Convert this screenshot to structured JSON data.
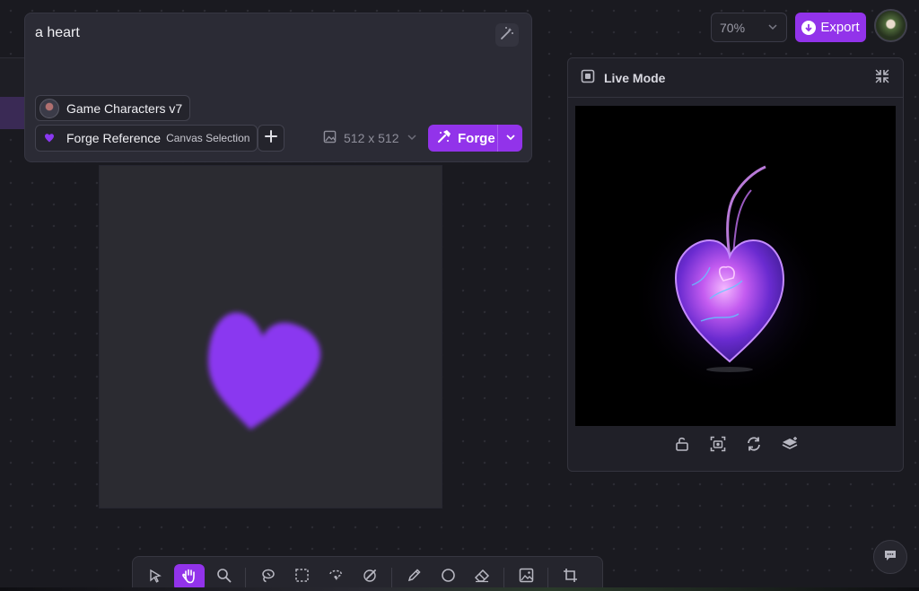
{
  "prompt": {
    "text": "a heart",
    "model_label": "Game Characters v7",
    "reference_label": "Forge Reference",
    "reference_sub": "Canvas Selection",
    "size_label": "512 x 512",
    "forge_label": "Forge"
  },
  "header": {
    "zoom_label": "70%",
    "export_label": "Export"
  },
  "live_mode": {
    "title": "Live Mode"
  },
  "colors": {
    "accent": "#9233ea",
    "heart_sketch": "#8a38f0"
  },
  "toolbar": {
    "tools": [
      "select-arrow-icon",
      "hand-icon",
      "zoom-icon",
      "lasso-icon",
      "marquee-icon",
      "lasso-select-icon",
      "brush-icon",
      "pencil-icon",
      "ellipse-icon",
      "eraser-icon",
      "image-icon",
      "crop-icon"
    ],
    "active_tool": "hand-icon"
  }
}
